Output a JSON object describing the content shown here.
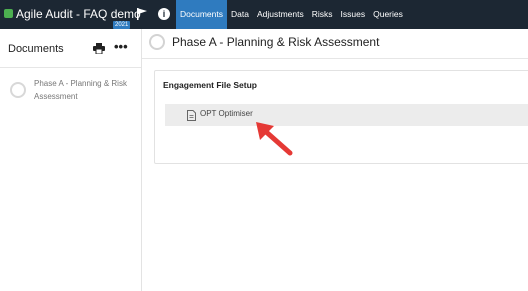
{
  "app": {
    "title": "Agile Audit - FAQ demo",
    "year_badge": "2021"
  },
  "nav": {
    "items": [
      {
        "label": "Documents",
        "active": true
      },
      {
        "label": "Data",
        "active": false
      },
      {
        "label": "Adjustments",
        "active": false
      },
      {
        "label": "Risks",
        "active": false
      },
      {
        "label": "Issues",
        "active": false
      },
      {
        "label": "Queries",
        "active": false
      }
    ]
  },
  "sidebar": {
    "title": "Documents",
    "items": [
      {
        "label": "Phase A - Planning & Risk Assessment"
      }
    ]
  },
  "main": {
    "title": "Phase A - Planning & Risk Assessment",
    "card": {
      "title": "Engagement File Setup",
      "rows": [
        {
          "label": "OPT Optimiser"
        }
      ]
    }
  },
  "colors": {
    "topbar": "#1c2733",
    "active_tab": "#2f7bbf",
    "app_dot": "#4caf50",
    "annotation_arrow": "#e53935"
  },
  "icons": [
    "flag-icon",
    "info-icon",
    "print-icon",
    "more-icon",
    "document-icon",
    "status-circle-icon"
  ]
}
